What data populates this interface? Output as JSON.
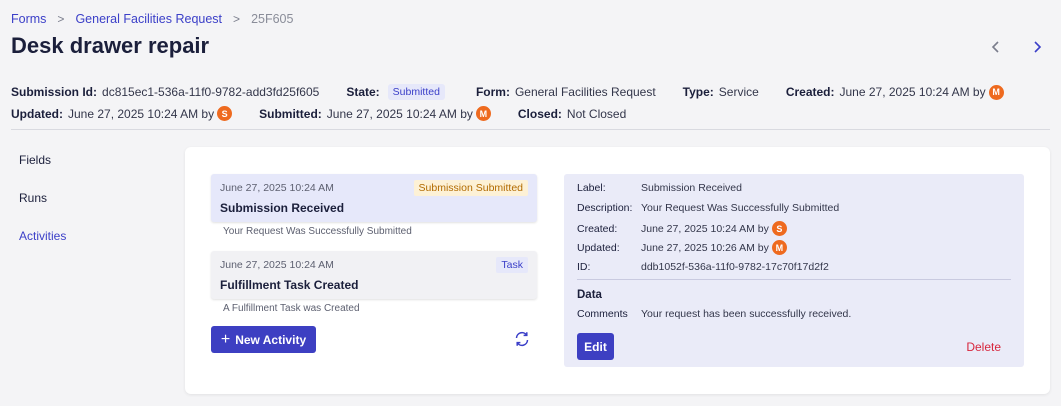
{
  "breadcrumb": {
    "items": [
      "Forms",
      "General Facilities Request",
      "25F605"
    ],
    "separator": ">"
  },
  "page_title": "Desk drawer repair",
  "meta": {
    "submission_id_label": "Submission Id:",
    "submission_id": "dc815ec1-536a-11f0-9782-add3fd25f605",
    "state_label": "State:",
    "state": "Submitted",
    "form_label": "Form:",
    "form": "General Facilities Request",
    "type_label": "Type:",
    "type": "Service",
    "created_label": "Created:",
    "created": "June 27, 2025 10:24 AM by",
    "created_by": "M",
    "updated_label": "Updated:",
    "updated": "June 27, 2025 10:24 AM by",
    "updated_by": "S",
    "submitted_label": "Submitted:",
    "submitted": "June 27, 2025 10:24 AM by",
    "submitted_by": "M",
    "closed_label": "Closed:",
    "closed": "Not Closed"
  },
  "tabs": [
    "Fields",
    "Runs",
    "Activities"
  ],
  "activities": [
    {
      "date": "June 27, 2025 10:24 AM",
      "tag": "Submission Submitted",
      "title": "Submission Received",
      "description": "Your Request Was Successfully Submitted"
    },
    {
      "date": "June 27, 2025 10:24 AM",
      "tag": "Task",
      "title": "Fulfillment Task Created",
      "description": "A Fulfillment Task was Created"
    }
  ],
  "new_activity_label": "New Activity",
  "details": {
    "label_key": "Label:",
    "label": "Submission Received",
    "description_key": "Description:",
    "description": "Your Request Was Successfully Submitted",
    "created_key": "Created:",
    "created": "June 27, 2025 10:24 AM by",
    "created_by": "S",
    "updated_key": "Updated:",
    "updated": "June 27, 2025 10:26 AM by",
    "updated_by": "M",
    "id_key": "ID:",
    "id": "ddb1052f-536a-11f0-9782-17c70f17d2f2",
    "data_heading": "Data",
    "comments_key": "Comments",
    "comments": "Your request has been successfully received.",
    "edit_label": "Edit",
    "delete_label": "Delete"
  },
  "colors": {
    "accent": "#3d3fc2",
    "avatar": "#ee6a1f",
    "delete": "#d7263d",
    "panel": "#eaebf8",
    "selected_activity": "#e6e8fa",
    "tag_submitted_bg": "#fdf1d6",
    "tag_submitted_text": "#b26b00"
  },
  "icons": [
    "chevron-right-icon",
    "chevron-left-icon",
    "plus-icon",
    "refresh-icon"
  ]
}
